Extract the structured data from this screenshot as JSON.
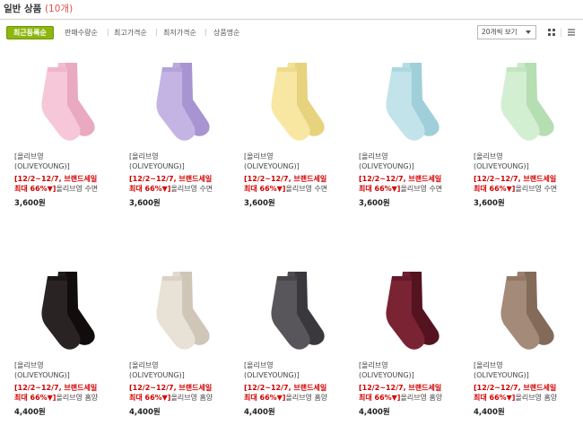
{
  "header": {
    "title": "일반 상품",
    "count": "(10개)"
  },
  "toolbar": {
    "sort_active": "최근등록순",
    "sort_options": [
      "판매수량순",
      "최고가격순",
      "최저가격순",
      "상품명순"
    ],
    "per_page": "20개씩 보기"
  },
  "products": [
    {
      "brand": "[올리브영",
      "brand2": "(OLIVEYOUNG)]",
      "promo1": "[12/2~12/7, 브랜드세일",
      "promo2a": "최대 66%▼]",
      "promo2b": "올리브영 수면",
      "price": "3,600원",
      "color": "#f6c7d8",
      "shade": "#e9a9c0"
    },
    {
      "brand": "[올리브영",
      "brand2": "(OLIVEYOUNG)]",
      "promo1": "[12/2~12/7, 브랜드세일",
      "promo2a": "최대 66%▼]",
      "promo2b": "올리브영 수면",
      "price": "3,600원",
      "color": "#c4b4e3",
      "shade": "#a894d0"
    },
    {
      "brand": "[올리브영",
      "brand2": "(OLIVEYOUNG)]",
      "promo1": "[12/2~12/7, 브랜드세일",
      "promo2a": "최대 66%▼]",
      "promo2b": "올리브영 수면",
      "price": "3,600원",
      "color": "#f8e7a3",
      "shade": "#e7d27e"
    },
    {
      "brand": "[올리브영",
      "brand2": "(OLIVEYOUNG)]",
      "promo1": "[12/2~12/7, 브랜드세일",
      "promo2a": "최대 66%▼]",
      "promo2b": "올리브영 수면",
      "price": "3,600원",
      "color": "#c2e3ea",
      "shade": "#9fcfd9"
    },
    {
      "brand": "[올리브영",
      "brand2": "(OLIVEYOUNG)]",
      "promo1": "[12/2~12/7, 브랜드세일",
      "promo2a": "최대 66%▼]",
      "promo2b": "올리브영 수면",
      "price": "3,600원",
      "color": "#d3efd2",
      "shade": "#b5deb3"
    },
    {
      "brand": "[올리브영",
      "brand2": "(OLIVEYOUNG)]",
      "promo1": "[12/2~12/7, 브랜드세일",
      "promo2a": "최대 66%▼]",
      "promo2b": "올리브영 홈양",
      "price": "4,400원",
      "color": "#2a2323",
      "shade": "#120d0d"
    },
    {
      "brand": "[올리브영",
      "brand2": "(OLIVEYOUNG)]",
      "promo1": "[12/2~12/7, 브랜드세일",
      "promo2a": "최대 66%▼]",
      "promo2b": "올리브영 홈양",
      "price": "4,400원",
      "color": "#e8e1d6",
      "shade": "#cfc6b7"
    },
    {
      "brand": "[올리브영",
      "brand2": "(OLIVEYOUNG)]",
      "promo1": "[12/2~12/7, 브랜드세일",
      "promo2a": "최대 66%▼]",
      "promo2b": "올리브영 홈양",
      "price": "4,400원",
      "color": "#58565a",
      "shade": "#3a383c"
    },
    {
      "brand": "[올리브영",
      "brand2": "(OLIVEYOUNG)]",
      "promo1": "[12/2~12/7, 브랜드세일",
      "promo2a": "최대 66%▼]",
      "promo2b": "올리브영 홈양",
      "price": "4,400원",
      "color": "#7a2333",
      "shade": "#55131f"
    },
    {
      "brand": "[올리브영",
      "brand2": "(OLIVEYOUNG)]",
      "promo1": "[12/2~12/7, 브랜드세일",
      "promo2a": "최대 66%▼]",
      "promo2b": "올리브영 홈양",
      "price": "4,400원",
      "color": "#a48a78",
      "shade": "#846a58"
    }
  ]
}
